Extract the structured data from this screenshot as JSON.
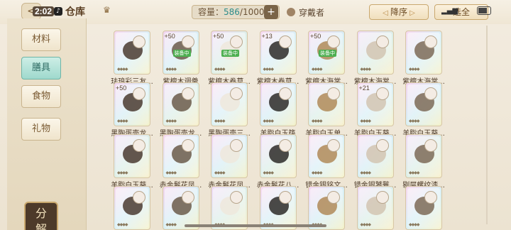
{
  "statusbar": {
    "time": "2:02"
  },
  "header": {
    "title": "仓库",
    "capacity_label": "容量：",
    "capacity_current": "586",
    "capacity_total": "/1000",
    "add_symbol": "+",
    "wearing_label": "穿戴者",
    "sort_label": "降序",
    "filter_label": "选全"
  },
  "categories": [
    {
      "label": "材料",
      "active": false
    },
    {
      "label": "膳具",
      "active": true
    },
    {
      "label": "食物",
      "active": false
    },
    {
      "label": "礼物",
      "active": false
    }
  ],
  "decompose_label_1": "分",
  "decompose_label_2": "解",
  "items": [
    {
      "name": "珐琅彩三友...",
      "badge": "",
      "tag": ""
    },
    {
      "name": "紫檀木调羹",
      "badge": "+50",
      "tag": "装备中"
    },
    {
      "name": "紫檀木卷草...",
      "badge": "+50",
      "tag": "装备中"
    },
    {
      "name": "紫檀木卷草...",
      "badge": "+13",
      "tag": ""
    },
    {
      "name": "紫檀木海棠...",
      "badge": "+50",
      "tag": "装备中"
    },
    {
      "name": "紫檀木海棠...",
      "badge": "",
      "tag": ""
    },
    {
      "name": "紫檀木海棠...",
      "badge": "",
      "tag": ""
    },
    {
      "name": "黑陶蛋壳龙...",
      "badge": "+50",
      "tag": ""
    },
    {
      "name": "黑陶蛋壳龙...",
      "badge": "",
      "tag": ""
    },
    {
      "name": "黑陶蛋壳三...",
      "badge": "",
      "tag": ""
    },
    {
      "name": "羊脂白玉筷",
      "badge": "",
      "tag": ""
    },
    {
      "name": "羊脂白玉单...",
      "badge": "",
      "tag": ""
    },
    {
      "name": "羊脂白玉葵...",
      "badge": "+21",
      "tag": ""
    },
    {
      "name": "羊脂白玉葵...",
      "badge": "",
      "tag": ""
    },
    {
      "name": "羊脂白玉葵...",
      "badge": "",
      "tag": ""
    },
    {
      "name": "赤金鬈花凤...",
      "badge": "",
      "tag": ""
    },
    {
      "name": "赤金鬈花凤...",
      "badge": "",
      "tag": ""
    },
    {
      "name": "赤金鬈花八...",
      "badge": "",
      "tag": ""
    },
    {
      "name": "错金银铭文...",
      "badge": "",
      "tag": ""
    },
    {
      "name": "错金银饕餮...",
      "badge": "",
      "tag": ""
    },
    {
      "name": "剔犀螺纹漆...",
      "badge": "",
      "tag": ""
    },
    {
      "name": "",
      "badge": "",
      "tag": ""
    },
    {
      "name": "",
      "badge": "",
      "tag": ""
    },
    {
      "name": "",
      "badge": "",
      "tag": ""
    },
    {
      "name": "",
      "badge": "",
      "tag": ""
    },
    {
      "name": "",
      "badge": "",
      "tag": ""
    },
    {
      "name": "",
      "badge": "",
      "tag": ""
    },
    {
      "name": "",
      "badge": "",
      "tag": ""
    }
  ],
  "colors": {
    "rainbow_a": "#f7d8ef",
    "rainbow_b": "#d9f0f7",
    "rainbow_c": "#f7f3cf",
    "active_tab": "#9fd9cd",
    "equipped_tag": "#4caf50"
  }
}
